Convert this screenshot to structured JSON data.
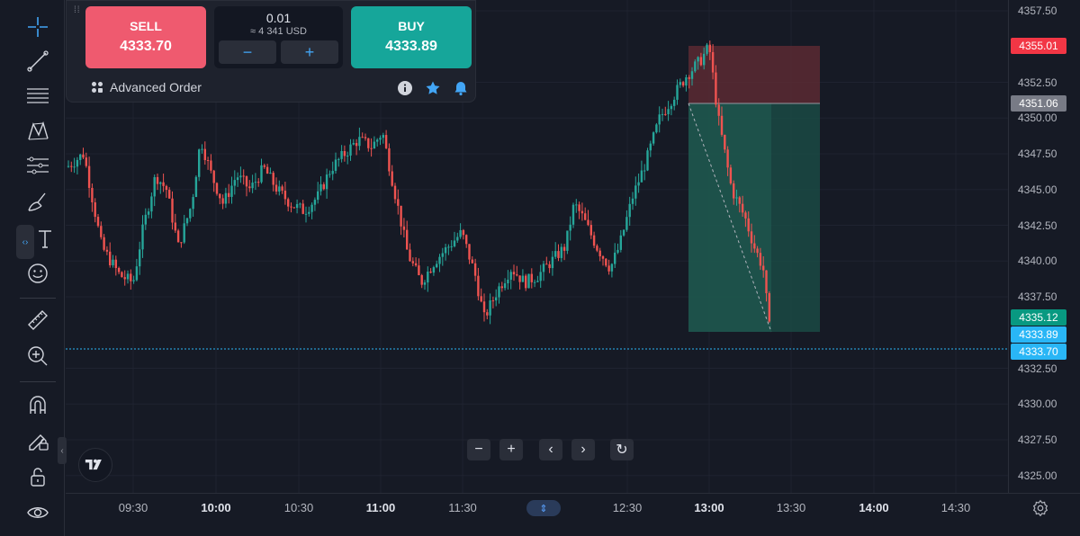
{
  "order_panel": {
    "sell_label": "SELL",
    "sell_price": "4333.70",
    "buy_label": "BUY",
    "buy_price": "4333.89",
    "quantity": "0.01",
    "quantity_usd": "≈ 4 341 USD",
    "minus_label": "−",
    "plus_label": "+",
    "advanced_order_label": "Advanced Order"
  },
  "price_axis": {
    "ticks": [
      "4357.50",
      "4352.50",
      "4350.00",
      "4347.50",
      "4345.00",
      "4342.50",
      "4340.00",
      "4337.50",
      "4332.50",
      "4330.00",
      "4327.50",
      "4325.00"
    ],
    "stop_loss_label": "4355.01",
    "entry_label": "4351.06",
    "take_profit_label": "4335.12",
    "ask_label": "4333.89",
    "bid_label": "4333.70"
  },
  "time_axis": {
    "ticks": [
      {
        "label": "09:30",
        "bold": false
      },
      {
        "label": "10:00",
        "bold": true
      },
      {
        "label": "10:30",
        "bold": false
      },
      {
        "label": "11:00",
        "bold": true
      },
      {
        "label": "11:30",
        "bold": false
      },
      {
        "label": "12:30",
        "bold": false
      },
      {
        "label": "13:00",
        "bold": true
      },
      {
        "label": "13:30",
        "bold": false
      },
      {
        "label": "14:00",
        "bold": true
      },
      {
        "label": "14:30",
        "bold": false
      }
    ]
  },
  "nav_buttons": {
    "zoom_out": "−",
    "zoom_in": "+",
    "scroll_left": "‹",
    "scroll_right": "›",
    "reset": "↻"
  },
  "colors": {
    "sell": "#ef5a6f",
    "buy": "#16a69a",
    "candle_up": "#26a69a",
    "candle_down": "#ef5350",
    "stop_zone": "#5b2a33",
    "profit_zone": "#1a4a44",
    "bid_line": "#29b6f6"
  },
  "toolbar_icons": [
    "crosshair-icon",
    "trend-line-icon",
    "horizontal-lines-icon",
    "pattern-icon",
    "fib-icon",
    "brush-icon",
    "text-icon",
    "emoji-icon",
    "ruler-icon",
    "zoom-icon",
    "magnet-icon",
    "lock-draw-icon",
    "unlock-icon",
    "eye-icon"
  ]
}
